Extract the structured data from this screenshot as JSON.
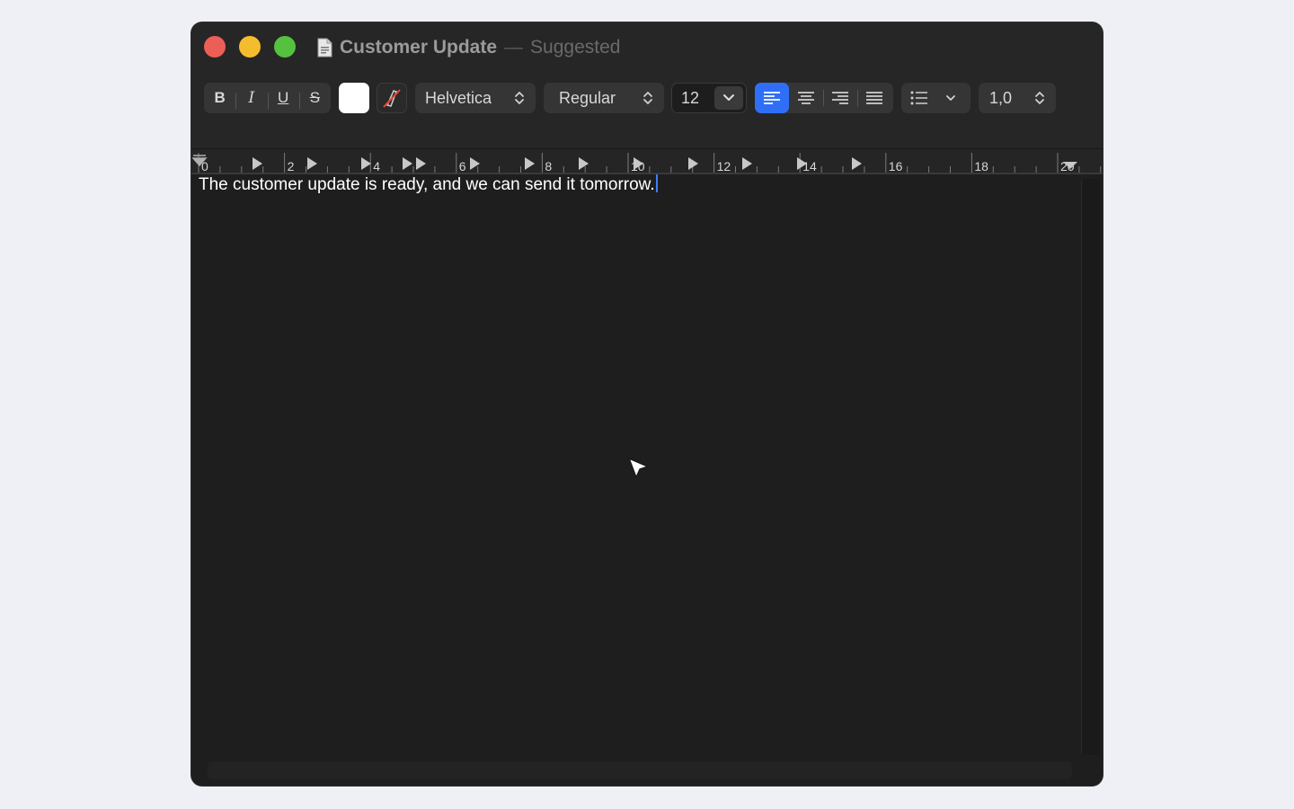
{
  "window": {
    "title": "Customer Update",
    "title_separator": "—",
    "status": "Suggested",
    "doc_icon": "document-icon"
  },
  "toolbar": {
    "bold_label": "B",
    "italic_label": "I",
    "underline_label": "U",
    "strikethrough_label": "S",
    "text_color": "#ffffff",
    "font_family": "Helvetica",
    "font_style": "Regular",
    "font_size": "12",
    "alignment_selected": "left",
    "line_spacing": "1,0",
    "list_icon": "bullet-list-icon"
  },
  "ruler": {
    "labels": [
      "0",
      "2",
      "4",
      "6",
      "8",
      "10",
      "12",
      "14",
      "16",
      "18",
      "20"
    ]
  },
  "document": {
    "text": "The customer update is ready, and we can send it tomorrow."
  },
  "colors": {
    "accent": "#2f6ff7",
    "window_bg": "#1e1e1e",
    "close": "#ec5f57",
    "minimize": "#f5bd2e",
    "zoom": "#55c13f"
  }
}
